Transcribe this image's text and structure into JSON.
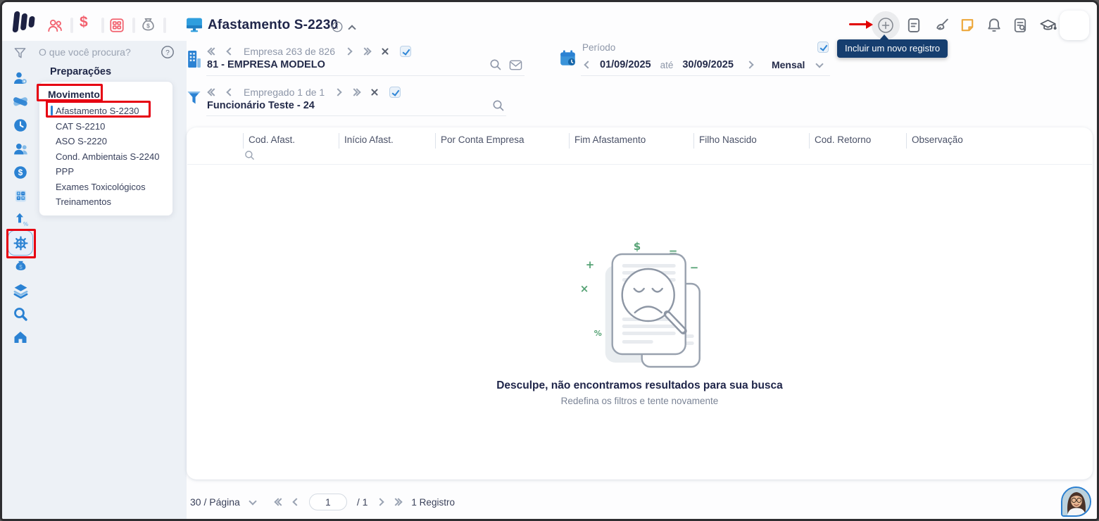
{
  "topbar": {
    "title": "Afastamento S-2230",
    "tooltip": "Incluir um novo registro"
  },
  "sidebar": {
    "search_placeholder": "O que você procura?",
    "section_title": "Preparações",
    "menu_group": "Movimento",
    "menu_items": [
      "Afastamento S-2230",
      "CAT S-2210",
      "ASO S-2220",
      "Cond. Ambientais S-2240",
      "PPP",
      "Exames Toxicológicos",
      "Treinamentos"
    ]
  },
  "company_nav": {
    "counter": "Empresa 263 de 826",
    "name": "81 - EMPRESA MODELO"
  },
  "employee_nav": {
    "counter": "Empregado 1 de 1",
    "name": "Funcionário Teste - 24"
  },
  "period": {
    "label": "Período",
    "start_date": "01/09/2025",
    "until": "até",
    "end_date": "30/09/2025",
    "mode": "Mensal"
  },
  "table": {
    "columns": [
      "Cod. Afast.",
      "Início Afast.",
      "Por Conta Empresa",
      "Fim Afastamento",
      "Filho Nascido",
      "Cod. Retorno",
      "Observação"
    ]
  },
  "empty_state": {
    "title": "Desculpe, não encontramos resultados para sua busca",
    "subtitle": "Redefina os filtros e tente novamente"
  },
  "pagination": {
    "page_size": "30 / Página",
    "current_page": "1",
    "page_total": "/ 1",
    "records": "1 Registro"
  },
  "icons": {
    "topbar_left": [
      "logo",
      "people-icon",
      "dollar-icon",
      "calculator-icon",
      "money-bag-icon"
    ],
    "topbar_right": [
      "add-record-icon",
      "file-text-icon",
      "broom-icon",
      "sticky-note-icon",
      "bell-icon",
      "file-search-icon",
      "graduation-cap-icon"
    ],
    "sidebar_rail": [
      "user-gear-icon",
      "handshake-icon",
      "clock-icon",
      "employees-icon",
      "coin-icon",
      "calculator-icon",
      "raise-percent-icon",
      "esocial-gear-icon",
      "money-bag-icon",
      "layers-icon",
      "search-icon",
      "home-icon"
    ]
  },
  "colors": {
    "accent_blue": "#2b82d3",
    "accent_red": "#f2616e",
    "annotation_red": "#e60012",
    "tooltip_bg": "#163e6f",
    "navy_text": "#242b4a",
    "note_yellow": "#eda73b",
    "empty_green": "#55a274",
    "sidebar_bg": "#edf1f6"
  }
}
